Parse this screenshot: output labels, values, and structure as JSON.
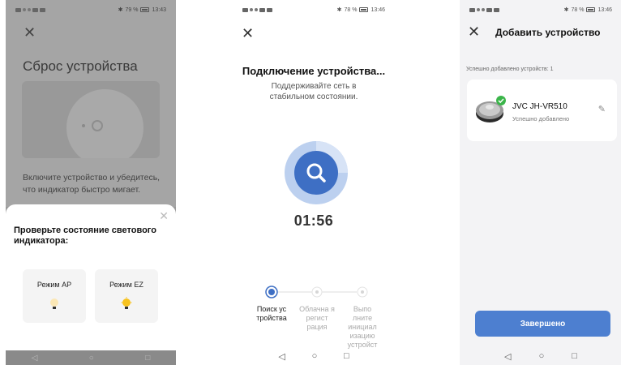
{
  "screen1": {
    "status": {
      "time": "13:43",
      "battery": "79 %"
    },
    "title": "Сброс устройства",
    "body": "Включите устройство и убедитесь, что индикатор быстро мигает.",
    "sheet": {
      "title": "Проверьте состояние светового индикатора:",
      "modes": [
        {
          "label": "Режим AP"
        },
        {
          "label": "Режим EZ"
        }
      ]
    }
  },
  "screen2": {
    "status": {
      "time": "13:46",
      "battery": "78 %"
    },
    "title": "Подключение устройства...",
    "subtitle": "Поддерживайте сеть в стабильном состоянии.",
    "timer": "01:56",
    "steps": [
      {
        "label": "Поиск ус тройства",
        "active": true
      },
      {
        "label": "Облачна я регист рация",
        "active": false
      },
      {
        "label": "Выпо лните инициал изацию устройст",
        "active": false
      }
    ],
    "accent": "#3e6fc4"
  },
  "screen3": {
    "status": {
      "time": "13:46",
      "battery": "78 %"
    },
    "header_title": "Добавить устройство",
    "added_count": "Успешно добавлено устройств: 1",
    "device": {
      "name": "JVC JH-VR510",
      "status": "Успешно добавлено"
    },
    "done_button": "Завершено",
    "accent": "#4d7fd0",
    "success_color": "#3bb54a"
  },
  "icons": [
    "close-icon",
    "search-icon",
    "edit-icon",
    "check-icon",
    "back-nav-icon",
    "home-nav-icon",
    "recent-nav-icon",
    "bulb-icon"
  ]
}
